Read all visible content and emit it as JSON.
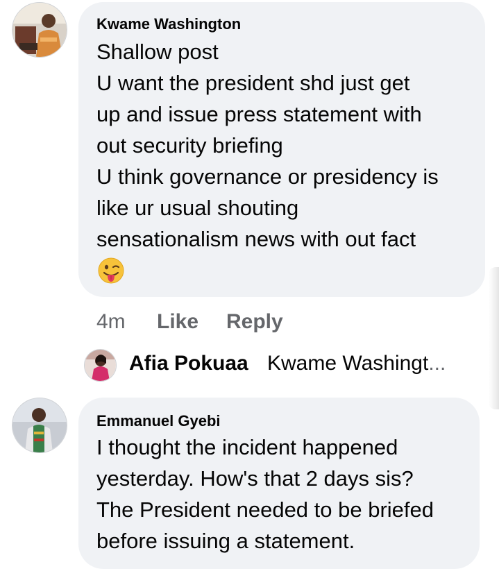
{
  "comments": [
    {
      "author": "Kwame Washington",
      "lines": [
        "Shallow post",
        "U want the president shd just get",
        "up and issue press statement with",
        "out security briefing",
        "U think governance or presidency is",
        "like ur usual shouting",
        "sensationalism news with out fact"
      ],
      "emoji": "winking-face-with-tongue",
      "time": "4m",
      "like_label": "Like",
      "reply_label": "Reply",
      "reply_preview": {
        "author": "Afia Pokuaa",
        "text": "Kwame Washingt",
        "ellipsis": "..."
      }
    },
    {
      "author": "Emmanuel Gyebi",
      "lines": [
        "I thought the incident happened",
        "yesterday. How's that 2 days sis?",
        "The President needed to be briefed",
        "before issuing a statement."
      ]
    }
  ],
  "colors": {
    "bubble": "#f0f2f5",
    "text": "#050505",
    "secondary": "#65676b"
  }
}
